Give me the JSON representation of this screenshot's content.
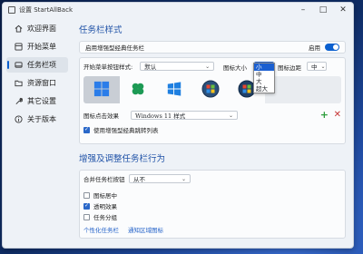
{
  "window": {
    "title": "设置 StartAllBack"
  },
  "sidebar": {
    "items": [
      {
        "label": "欢迎界面",
        "icon": "house-icon",
        "active": false
      },
      {
        "label": "开始菜单",
        "icon": "start-menu-icon",
        "active": false
      },
      {
        "label": "任务栏项",
        "icon": "taskbar-icon",
        "active": true
      },
      {
        "label": "资源窗口",
        "icon": "folder-icon",
        "active": false
      },
      {
        "label": "其它设置",
        "icon": "wrench-icon",
        "active": false
      },
      {
        "label": "关于版本",
        "icon": "info-icon",
        "active": false
      }
    ]
  },
  "taskbar_style": {
    "title": "任务栏样式",
    "enhanced_label": "启用增强型经典任务栏",
    "enable_label": "启用",
    "enabled": true,
    "start_button_style_label": "开始菜单按钮样式:",
    "start_button_style_value": "默认",
    "icon_size_label": "图标大小",
    "icon_size_value": "小",
    "icon_margin_label": "图标边距",
    "icon_margin_value": "中",
    "icon_size_options": [
      "小",
      "中",
      "大",
      "超大"
    ],
    "icon_size_selected_index": 0,
    "start_icons": [
      "windows-11-logo-icon",
      "clover-icon",
      "windows-10-logo-icon",
      "windows-7-orb-icon",
      "windows-vista-orb-icon"
    ],
    "selected_start_icon_index": 0,
    "icon_effect_label": "图标点击效果",
    "icon_effect_value": "Windows 11 样式",
    "use_enhanced_list_label": "使用增强型经典跳转列表",
    "use_enhanced_list_checked": true
  },
  "enhance": {
    "title": "增强及调整任务栏行为",
    "combine_label": "合并任务栏按钮",
    "combine_value": "从不",
    "checkboxes": [
      {
        "label": "图标居中",
        "checked": false
      },
      {
        "label": "透明效果",
        "checked": true
      },
      {
        "label": "任务分组",
        "checked": false
      }
    ],
    "links": [
      "个性化任务栏",
      "通知区域图标"
    ]
  },
  "colors": {
    "accent": "#0a5fcf",
    "add": "#2e9e3e",
    "remove": "#c73636"
  }
}
